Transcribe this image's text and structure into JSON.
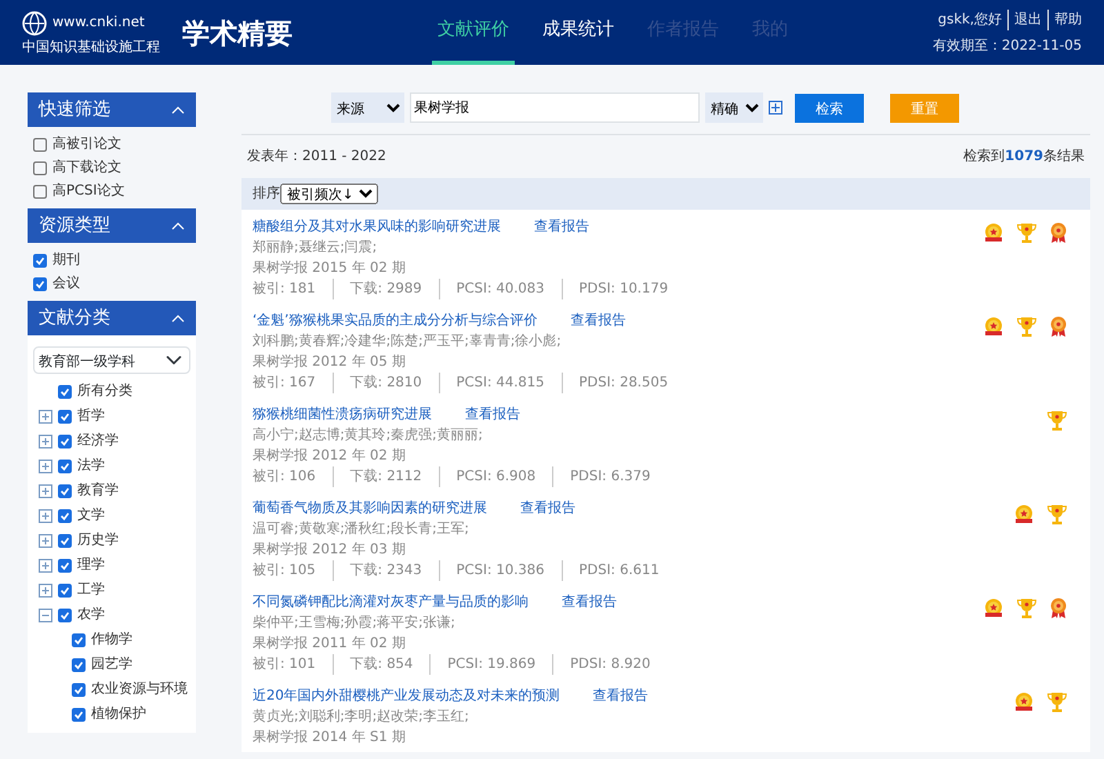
{
  "header": {
    "logo_text": "www.cnki.net",
    "logo_subtitle": "中国知识基础设施工程",
    "app_title": "学术精要",
    "nav": [
      {
        "label": "文献评价",
        "selected": true,
        "disabled": false
      },
      {
        "label": "成果统计",
        "selected": false,
        "disabled": false
      },
      {
        "label": "作者报告",
        "selected": false,
        "disabled": true
      },
      {
        "label": "我的",
        "selected": false,
        "disabled": true
      }
    ],
    "user": "gskk,您好",
    "links": [
      "退出",
      "帮助"
    ],
    "expiry": "有效期至：2022-11-05"
  },
  "sidebar": {
    "sections": [
      {
        "title": "快速筛选",
        "expanded": true,
        "kind": "checks",
        "items": [
          {
            "label": "高被引论文",
            "checked": false
          },
          {
            "label": "高下载论文",
            "checked": false
          },
          {
            "label": "高PCSI论文",
            "checked": false
          }
        ]
      },
      {
        "title": "资源类型",
        "expanded": true,
        "kind": "checks",
        "items": [
          {
            "label": "期刊",
            "checked": true
          },
          {
            "label": "会议",
            "checked": true
          }
        ]
      },
      {
        "title": "文献分类",
        "expanded": true,
        "kind": "tree",
        "select": "教育部一级学科",
        "items": [
          {
            "label": "所有分类",
            "checked": true
          },
          {
            "label": "哲学",
            "checked": true,
            "expanded": false
          },
          {
            "label": "经济学",
            "checked": true,
            "expanded": false
          },
          {
            "label": "法学",
            "checked": true,
            "expanded": false
          },
          {
            "label": "教育学",
            "checked": true,
            "expanded": false
          },
          {
            "label": "文学",
            "checked": true,
            "expanded": false
          },
          {
            "label": "历史学",
            "checked": true,
            "expanded": false
          },
          {
            "label": "理学",
            "checked": true,
            "expanded": false
          },
          {
            "label": "工学",
            "checked": true,
            "expanded": false
          },
          {
            "label": "农学",
            "checked": true,
            "expanded": true,
            "children": [
              {
                "label": "作物学",
                "checked": true
              },
              {
                "label": "园艺学",
                "checked": true
              },
              {
                "label": "农业资源与环境",
                "checked": true
              },
              {
                "label": "植物保护",
                "checked": true
              }
            ]
          }
        ]
      }
    ]
  },
  "search": {
    "field": "来源",
    "query": "果树学报",
    "match": "精确",
    "search_button": "检索",
    "reset_button": "重置"
  },
  "summary": {
    "years": "发表年：2011 - 2022",
    "count_prefix": "检索到",
    "count": "1079",
    "count_suffix": "条结果"
  },
  "sort": {
    "label": "排序",
    "value": "被引频次↓"
  },
  "results": [
    {
      "title": "糖酸组分及其对水果风味的影响研究进展",
      "report": "查看报告",
      "authors": "郑丽静;聂继云;闫震;",
      "source": "果树学报 2015 年 02 期",
      "stats": [
        "被引: 181",
        "下载: 2989",
        "PCSI: 40.083",
        "PDSI: 10.179"
      ],
      "badges": [
        {
          "kind": "medal"
        },
        {
          "kind": "trophy"
        },
        {
          "kind": "ribbon"
        }
      ]
    },
    {
      "title": "‘金魁’猕猴桃果实品质的主成分分析与综合评价",
      "report": "查看报告",
      "authors": "刘科鹏;黄春辉;冷建华;陈楚;严玉平;辜青青;徐小彪;",
      "source": "果树学报 2012 年 05 期",
      "stats": [
        "被引: 167",
        "下载: 2810",
        "PCSI: 44.815",
        "PDSI: 28.505"
      ],
      "badges": [
        {
          "kind": "medal"
        },
        {
          "kind": "trophy"
        },
        {
          "kind": "ribbon"
        }
      ]
    },
    {
      "title": "猕猴桃细菌性溃疡病研究进展",
      "report": "查看报告",
      "authors": "高小宁;赵志博;黄其玲;秦虎强;黄丽丽;",
      "source": "果树学报 2012 年 02 期",
      "stats": [
        "被引: 106",
        "下载: 2112",
        "PCSI: 6.908",
        "PDSI: 6.379"
      ],
      "badges": [
        {
          "kind": "trophy"
        }
      ]
    },
    {
      "title": "葡萄香气物质及其影响因素的研究进展",
      "report": "查看报告",
      "authors": "温可睿;黄敬寒;潘秋红;段长青;王军;",
      "source": "果树学报 2012 年 03 期",
      "stats": [
        "被引: 105",
        "下载: 2343",
        "PCSI: 10.386",
        "PDSI: 6.611"
      ],
      "badges": [
        {
          "kind": "medal"
        },
        {
          "kind": "trophy"
        }
      ]
    },
    {
      "title": "不同氮磷钾配比滴灌对灰枣产量与品质的影响",
      "report": "查看报告",
      "authors": "柴仲平;王雪梅;孙霞;蒋平安;张谦;",
      "source": "果树学报 2011 年 02 期",
      "stats": [
        "被引: 101",
        "下载: 854",
        "PCSI: 19.869",
        "PDSI: 8.920"
      ],
      "badges": [
        {
          "kind": "medal"
        },
        {
          "kind": "trophy"
        },
        {
          "kind": "ribbon"
        }
      ]
    },
    {
      "title": "近20年国内外甜樱桃产业发展动态及对未来的预测",
      "report": "查看报告",
      "authors": "黄贞光;刘聪利;李明;赵改荣;李玉红;",
      "source": "果树学报 2014 年 S1 期",
      "badges": [
        {
          "kind": "medal"
        },
        {
          "kind": "trophy"
        }
      ]
    }
  ]
}
